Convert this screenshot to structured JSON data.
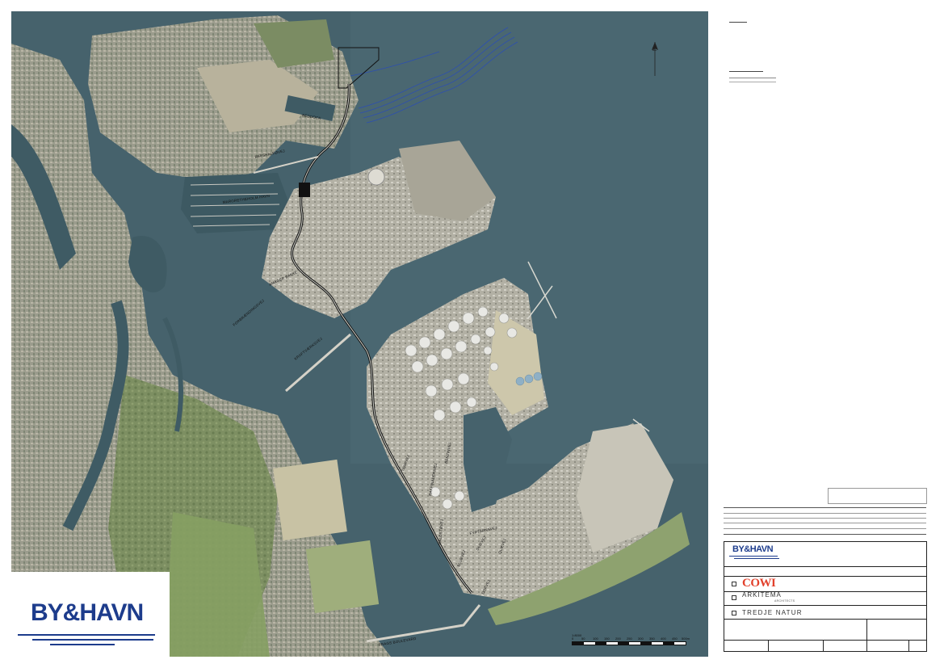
{
  "map": {
    "road_labels": [
      {
        "id": "refshaleoevej",
        "text": "REFSHALEØVEJ"
      },
      {
        "id": "margretheholm-havn",
        "text": "MARGRETHEHOLM HAVN"
      },
      {
        "id": "amager-bakke",
        "text": "AMAGER BAKKE"
      },
      {
        "id": "kraftvaerksvej",
        "text": "KRAFTVÆRKSVEJ"
      },
      {
        "id": "forbraendingsvej",
        "text": "FORBRÆNDINGSVEJ"
      },
      {
        "id": "prags-boulevard",
        "text": "PRAGS BOULEVARD"
      },
      {
        "id": "tankvej",
        "text": "TANKVEJ"
      },
      {
        "id": "benzinvej",
        "text": "BENZINVEJ"
      },
      {
        "id": "raffinaderivej",
        "text": "RAFFINADERIVEJ"
      },
      {
        "id": "kaldstoevej",
        "text": "KALDSTØVEJ"
      },
      {
        "id": "fyrtaarnsvej",
        "text": "FYRTÅRNSVEJ"
      },
      {
        "id": "olievej-1",
        "text": "OLIEVEJ"
      },
      {
        "id": "olievej-2",
        "text": "OLIEVEJ"
      },
      {
        "id": "bluevej",
        "text": "BLUEVEJ"
      },
      {
        "id": "dokvej",
        "text": "DOKVEJ"
      },
      {
        "id": "beddock",
        "text": "BEDDOCK"
      }
    ],
    "colors": {
      "water": "#46626c",
      "land": "#8f9b78",
      "urban": "#9a9a8c",
      "alignment": "#111111",
      "coastal_works": "#2d4fb0"
    }
  },
  "north_arrow": {
    "label": "N"
  },
  "scale_bar": {
    "title": "1:8000",
    "ticks": [
      "0",
      "50",
      "100",
      "150",
      "200",
      "250",
      "300",
      "350",
      "400",
      "450",
      "500m"
    ]
  },
  "brand": {
    "logo_text": "BY&HAVN",
    "color": "#1d3c8c"
  },
  "title_block": {
    "client_logo": "BY&HAVN",
    "firms": [
      {
        "name": "COWI",
        "color": "#e2412c"
      },
      {
        "name": "ARKITEMA",
        "sub": "ARCHITECTS"
      },
      {
        "name": "TREDJE NATUR"
      }
    ]
  }
}
